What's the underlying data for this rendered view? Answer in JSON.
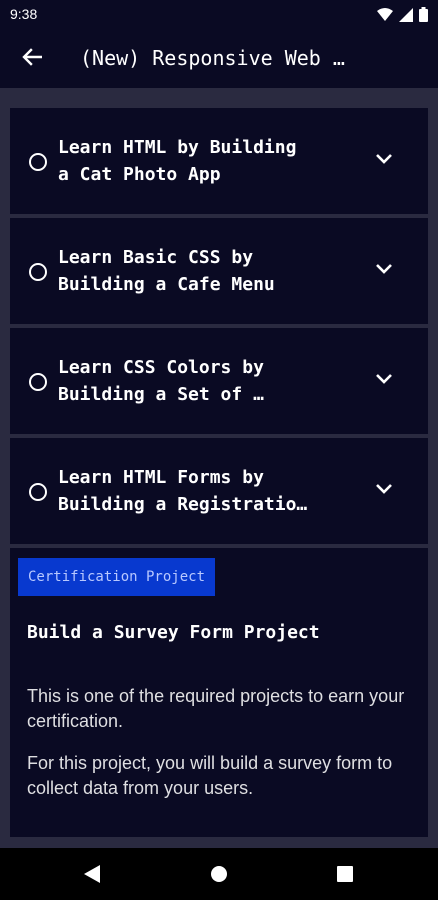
{
  "status_bar": {
    "time": "9:38",
    "icons": [
      "wifi-icon",
      "signal-icon",
      "battery-icon"
    ]
  },
  "app_bar": {
    "title": "(New) Responsive Web …",
    "back_icon": "arrow-left-icon"
  },
  "lessons": [
    {
      "label": "Learn HTML by Building\na Cat Photo App",
      "completed": false
    },
    {
      "label": "Learn Basic CSS by\nBuilding a Cafe Menu",
      "completed": false
    },
    {
      "label": "Learn CSS Colors by\nBuilding a Set of …",
      "completed": false
    },
    {
      "label": "Learn HTML Forms by\nBuilding a Registratio…",
      "completed": false
    }
  ],
  "project": {
    "badge": "Certification Project",
    "title": "Build a Survey Form Project",
    "paragraphs": [
      "This is one of the required projects to earn your certification.",
      "For this project, you will build a survey form to collect data from your users."
    ]
  },
  "nav_bar": {
    "icons": [
      "back-triangle-icon",
      "home-circle-icon",
      "recents-square-icon"
    ]
  },
  "colors": {
    "background": "#2a2a40",
    "surface": "#0a0a23",
    "badge": "#0839cf",
    "badge_text": "#b8c8ff",
    "text": "#ffffff"
  }
}
